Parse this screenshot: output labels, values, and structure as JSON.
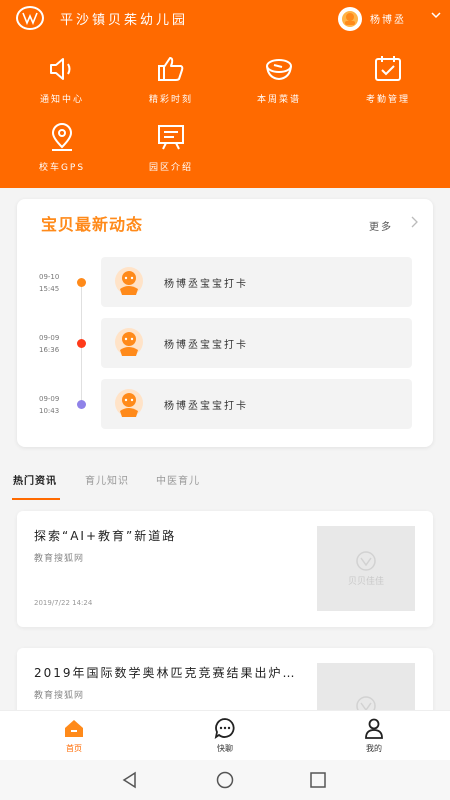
{
  "header": {
    "school_name": "平沙镇贝茱幼儿园",
    "user_name": "杨博丞"
  },
  "grid": [
    {
      "label": "通知中心",
      "icon": "speaker-icon"
    },
    {
      "label": "精彩时刻",
      "icon": "thumbs-up-icon"
    },
    {
      "label": "本周菜谱",
      "icon": "bowl-icon"
    },
    {
      "label": "考勤管理",
      "icon": "calendar-check-icon"
    },
    {
      "label": "校车GPS",
      "icon": "location-pin-icon"
    },
    {
      "label": "园区介绍",
      "icon": "presentation-board-icon"
    }
  ],
  "news": {
    "title": "宝贝最新动态",
    "more": "更多",
    "items": [
      {
        "date": "09-10",
        "time": "15:45",
        "text": "杨博丞宝宝打卡",
        "dot_color": "#ff8a1a"
      },
      {
        "date": "09-09",
        "time": "16:36",
        "text": "杨博丞宝宝打卡",
        "dot_color": "#ff3b1a"
      },
      {
        "date": "09-09",
        "time": "10:43",
        "text": "杨博丞宝宝打卡",
        "dot_color": "#8f82e8"
      }
    ]
  },
  "tabs": [
    {
      "label": "热门资讯"
    },
    {
      "label": "育儿知识"
    },
    {
      "label": "中医育儿"
    }
  ],
  "articles": [
    {
      "title": "探索“AI+教育”新道路",
      "source": "教育搜狐网",
      "date": "2019/7/22 14:24",
      "thumb_text": "贝贝佳佳"
    },
    {
      "title": "2019年国际数学奥林匹克竞赛结果出炉，...",
      "source": "教育搜狐网",
      "date": "",
      "thumb_text": ""
    }
  ],
  "bottom_nav": [
    {
      "label": "首页",
      "icon": "home-icon"
    },
    {
      "label": "快聊",
      "icon": "chat-icon"
    },
    {
      "label": "我的",
      "icon": "person-icon"
    }
  ],
  "colors": {
    "brand_orange": "#ff6a00",
    "title_orange": "#ff8a1a"
  }
}
